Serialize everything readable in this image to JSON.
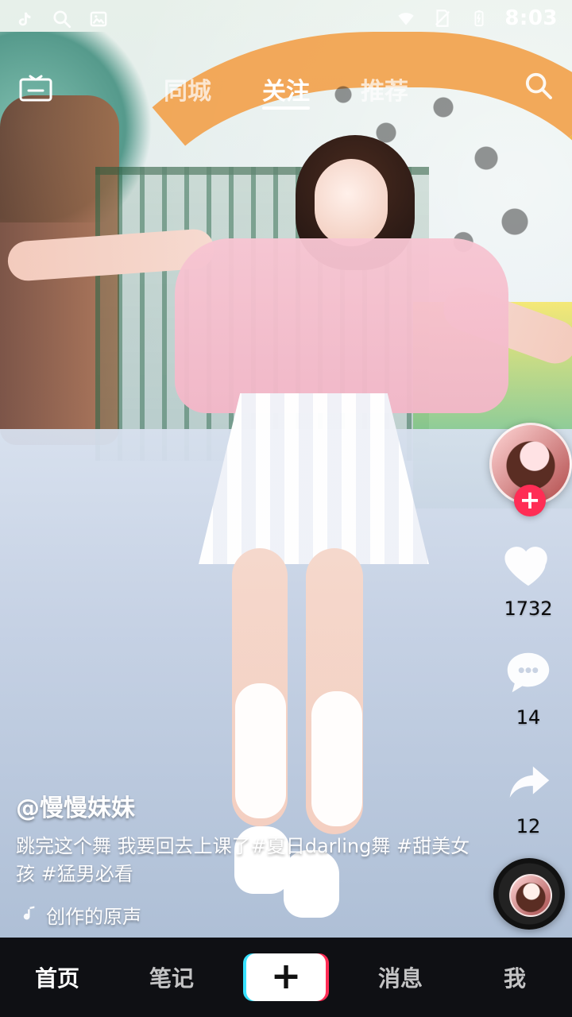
{
  "status_bar": {
    "time": "8:03",
    "left_icons": [
      "tiktok-icon",
      "search-icon",
      "image-icon"
    ],
    "right_icons": [
      "wifi-icon",
      "no-sim-icon",
      "battery-icon"
    ]
  },
  "top_nav": {
    "tabs": [
      {
        "label": "同城",
        "active": false
      },
      {
        "label": "关注",
        "active": true
      },
      {
        "label": "推荐",
        "active": false
      }
    ],
    "left_icon": "tv-icon",
    "right_icon": "search-icon"
  },
  "right_rail": {
    "likes": "1732",
    "comments": "14",
    "shares": "12"
  },
  "caption": {
    "username": "@慢慢妹妹",
    "text": "跳完这个舞 我要回去上课了#夏日darling舞 #甜美女孩 #猛男必看",
    "music": "创作的原声"
  },
  "bottom_nav": {
    "items": [
      {
        "label": "首页",
        "active": true
      },
      {
        "label": "笔记",
        "active": false
      },
      {
        "label": "消息",
        "active": false
      },
      {
        "label": "我",
        "active": false
      }
    ],
    "center_plus": "+"
  },
  "colors": {
    "accent_plus": "#ff2d55",
    "accent_cyan": "#38e1ff",
    "bottom_bar": "#0f1014"
  }
}
